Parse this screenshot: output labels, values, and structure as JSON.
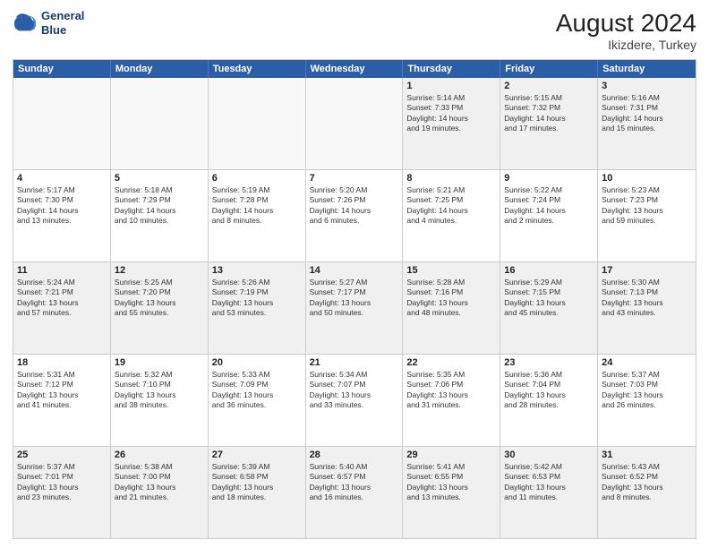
{
  "header": {
    "logo_line1": "General",
    "logo_line2": "Blue",
    "month": "August 2024",
    "location": "Ikizdere, Turkey"
  },
  "days_of_week": [
    "Sunday",
    "Monday",
    "Tuesday",
    "Wednesday",
    "Thursday",
    "Friday",
    "Saturday"
  ],
  "weeks": [
    [
      {
        "day": "",
        "info": "",
        "empty": true
      },
      {
        "day": "",
        "info": "",
        "empty": true
      },
      {
        "day": "",
        "info": "",
        "empty": true
      },
      {
        "day": "",
        "info": "",
        "empty": true
      },
      {
        "day": "1",
        "info": "Sunrise: 5:14 AM\nSunset: 7:33 PM\nDaylight: 14 hours\nand 19 minutes."
      },
      {
        "day": "2",
        "info": "Sunrise: 5:15 AM\nSunset: 7:32 PM\nDaylight: 14 hours\nand 17 minutes."
      },
      {
        "day": "3",
        "info": "Sunrise: 5:16 AM\nSunset: 7:31 PM\nDaylight: 14 hours\nand 15 minutes."
      }
    ],
    [
      {
        "day": "4",
        "info": "Sunrise: 5:17 AM\nSunset: 7:30 PM\nDaylight: 14 hours\nand 13 minutes."
      },
      {
        "day": "5",
        "info": "Sunrise: 5:18 AM\nSunset: 7:29 PM\nDaylight: 14 hours\nand 10 minutes."
      },
      {
        "day": "6",
        "info": "Sunrise: 5:19 AM\nSunset: 7:28 PM\nDaylight: 14 hours\nand 8 minutes."
      },
      {
        "day": "7",
        "info": "Sunrise: 5:20 AM\nSunset: 7:26 PM\nDaylight: 14 hours\nand 6 minutes."
      },
      {
        "day": "8",
        "info": "Sunrise: 5:21 AM\nSunset: 7:25 PM\nDaylight: 14 hours\nand 4 minutes."
      },
      {
        "day": "9",
        "info": "Sunrise: 5:22 AM\nSunset: 7:24 PM\nDaylight: 14 hours\nand 2 minutes."
      },
      {
        "day": "10",
        "info": "Sunrise: 5:23 AM\nSunset: 7:23 PM\nDaylight: 13 hours\nand 59 minutes."
      }
    ],
    [
      {
        "day": "11",
        "info": "Sunrise: 5:24 AM\nSunset: 7:21 PM\nDaylight: 13 hours\nand 57 minutes."
      },
      {
        "day": "12",
        "info": "Sunrise: 5:25 AM\nSunset: 7:20 PM\nDaylight: 13 hours\nand 55 minutes."
      },
      {
        "day": "13",
        "info": "Sunrise: 5:26 AM\nSunset: 7:19 PM\nDaylight: 13 hours\nand 53 minutes."
      },
      {
        "day": "14",
        "info": "Sunrise: 5:27 AM\nSunset: 7:17 PM\nDaylight: 13 hours\nand 50 minutes."
      },
      {
        "day": "15",
        "info": "Sunrise: 5:28 AM\nSunset: 7:16 PM\nDaylight: 13 hours\nand 48 minutes."
      },
      {
        "day": "16",
        "info": "Sunrise: 5:29 AM\nSunset: 7:15 PM\nDaylight: 13 hours\nand 45 minutes."
      },
      {
        "day": "17",
        "info": "Sunrise: 5:30 AM\nSunset: 7:13 PM\nDaylight: 13 hours\nand 43 minutes."
      }
    ],
    [
      {
        "day": "18",
        "info": "Sunrise: 5:31 AM\nSunset: 7:12 PM\nDaylight: 13 hours\nand 41 minutes."
      },
      {
        "day": "19",
        "info": "Sunrise: 5:32 AM\nSunset: 7:10 PM\nDaylight: 13 hours\nand 38 minutes."
      },
      {
        "day": "20",
        "info": "Sunrise: 5:33 AM\nSunset: 7:09 PM\nDaylight: 13 hours\nand 36 minutes."
      },
      {
        "day": "21",
        "info": "Sunrise: 5:34 AM\nSunset: 7:07 PM\nDaylight: 13 hours\nand 33 minutes."
      },
      {
        "day": "22",
        "info": "Sunrise: 5:35 AM\nSunset: 7:06 PM\nDaylight: 13 hours\nand 31 minutes."
      },
      {
        "day": "23",
        "info": "Sunrise: 5:36 AM\nSunset: 7:04 PM\nDaylight: 13 hours\nand 28 minutes."
      },
      {
        "day": "24",
        "info": "Sunrise: 5:37 AM\nSunset: 7:03 PM\nDaylight: 13 hours\nand 26 minutes."
      }
    ],
    [
      {
        "day": "25",
        "info": "Sunrise: 5:37 AM\nSunset: 7:01 PM\nDaylight: 13 hours\nand 23 minutes."
      },
      {
        "day": "26",
        "info": "Sunrise: 5:38 AM\nSunset: 7:00 PM\nDaylight: 13 hours\nand 21 minutes."
      },
      {
        "day": "27",
        "info": "Sunrise: 5:39 AM\nSunset: 6:58 PM\nDaylight: 13 hours\nand 18 minutes."
      },
      {
        "day": "28",
        "info": "Sunrise: 5:40 AM\nSunset: 6:57 PM\nDaylight: 13 hours\nand 16 minutes."
      },
      {
        "day": "29",
        "info": "Sunrise: 5:41 AM\nSunset: 6:55 PM\nDaylight: 13 hours\nand 13 minutes."
      },
      {
        "day": "30",
        "info": "Sunrise: 5:42 AM\nSunset: 6:53 PM\nDaylight: 13 hours\nand 11 minutes."
      },
      {
        "day": "31",
        "info": "Sunrise: 5:43 AM\nSunset: 6:52 PM\nDaylight: 13 hours\nand 8 minutes."
      }
    ]
  ]
}
